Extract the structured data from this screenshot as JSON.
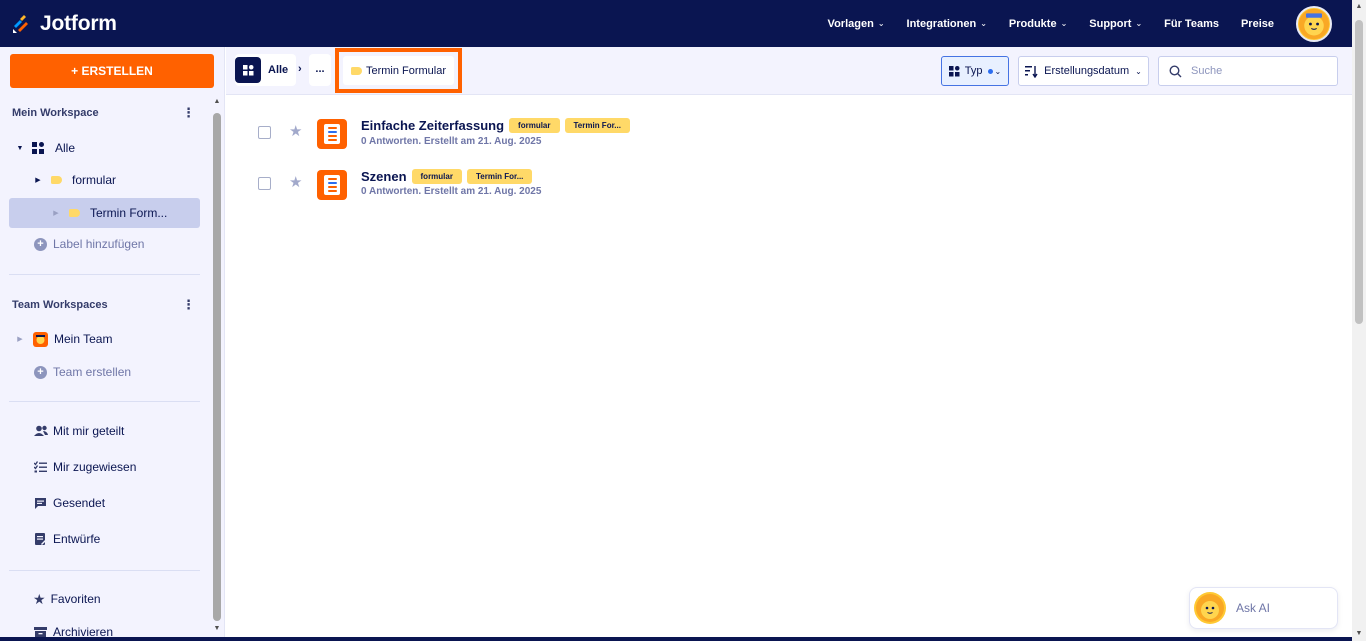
{
  "brand": {
    "name": "Jotform"
  },
  "nav": {
    "items": [
      {
        "label": "Vorlagen",
        "dropdown": true
      },
      {
        "label": "Integrationen",
        "dropdown": true
      },
      {
        "label": "Produkte",
        "dropdown": true
      },
      {
        "label": "Support",
        "dropdown": true
      },
      {
        "label": "Für Teams",
        "dropdown": false
      },
      {
        "label": "Preise",
        "dropdown": false
      }
    ]
  },
  "sidebar": {
    "create_label": "+ ERSTELLEN",
    "my_workspace_title": "Mein Workspace",
    "tree": {
      "all_label": "Alle",
      "formular_label": "formular",
      "termin_label": "Termin Form...",
      "add_label": "Label hinzufügen"
    },
    "team_title": "Team Workspaces",
    "team": {
      "my_team": "Mein Team",
      "create_team": "Team erstellen"
    },
    "links": {
      "shared": "Mit mir geteilt",
      "assigned": "Mir zugewiesen",
      "sent": "Gesendet",
      "drafts": "Entwürfe",
      "favorites": "Favoriten",
      "archive": "Archivieren"
    }
  },
  "toolbar": {
    "crumb_all": "Alle",
    "crumb_sep": "›",
    "crumb_dots": "...",
    "crumb_current": "Termin Formular",
    "type_label": "Typ",
    "sort_label": "Erstellungsdatum",
    "search_placeholder": "Suche"
  },
  "forms": [
    {
      "title": "Einfache Zeiterfassung",
      "tags": [
        "formular",
        "Termin For..."
      ],
      "meta": "0 Antworten. Erstellt am 21. Aug. 2025"
    },
    {
      "title": "Szenen",
      "tags": [
        "formular",
        "Termin For..."
      ],
      "meta": "0 Antworten. Erstellt am 21. Aug. 2025"
    }
  ],
  "ask_ai": {
    "label": "Ask AI"
  },
  "colors": {
    "navy": "#0a1551",
    "orange": "#ff6100",
    "tag": "#ffd968",
    "sidebar_bg": "#f3f3fe"
  }
}
